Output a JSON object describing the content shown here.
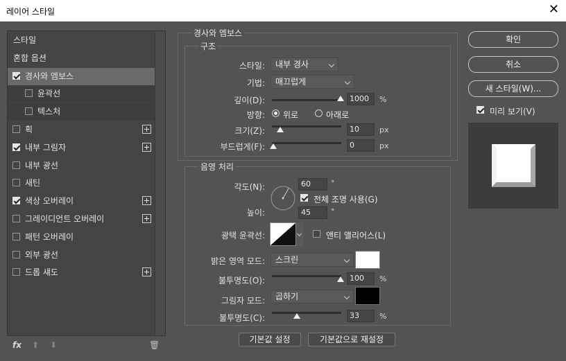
{
  "window": {
    "title": "레이어 스타일",
    "close_glyph": "✕"
  },
  "left": {
    "items": [
      {
        "label": "스타일",
        "has_check": false,
        "checked": false,
        "has_plus": false
      },
      {
        "label": "혼합 옵션",
        "has_check": false,
        "checked": false,
        "has_plus": false
      },
      {
        "label": "경사와 엠보스",
        "has_check": true,
        "checked": true,
        "has_plus": false,
        "selected": true
      },
      {
        "label": "윤곽선",
        "has_check": true,
        "checked": false,
        "has_plus": false,
        "sub": true
      },
      {
        "label": "텍스처",
        "has_check": true,
        "checked": false,
        "has_plus": false,
        "sub": true
      },
      {
        "label": "획",
        "has_check": true,
        "checked": false,
        "has_plus": true
      },
      {
        "label": "내부 그림자",
        "has_check": true,
        "checked": true,
        "has_plus": true
      },
      {
        "label": "내부 광선",
        "has_check": true,
        "checked": false,
        "has_plus": false
      },
      {
        "label": "새틴",
        "has_check": true,
        "checked": false,
        "has_plus": false
      },
      {
        "label": "색상 오버레이",
        "has_check": true,
        "checked": true,
        "has_plus": true
      },
      {
        "label": "그레이디언트 오버레이",
        "has_check": true,
        "checked": false,
        "has_plus": true
      },
      {
        "label": "패턴 오버레이",
        "has_check": true,
        "checked": false,
        "has_plus": false
      },
      {
        "label": "외부 광선",
        "has_check": true,
        "checked": false,
        "has_plus": false
      },
      {
        "label": "드롭 섀도",
        "has_check": true,
        "checked": false,
        "has_plus": true
      }
    ],
    "footer": {
      "fx": "fx",
      "up": "⬆",
      "down": "⬇",
      "trash": "🗑"
    }
  },
  "bevel": {
    "section_title": "경사와 엠보스",
    "structure_title": "구조",
    "style_label": "스타일:",
    "style_value": "내부 경사",
    "technique_label": "기법:",
    "technique_value": "매끄럽게",
    "depth_label": "깊이(D):",
    "depth_value": "1000",
    "depth_unit": "%",
    "direction_label": "방향:",
    "dir_up": "위로",
    "dir_down": "아래로",
    "size_label": "크기(Z):",
    "size_value": "10",
    "size_unit": "px",
    "soften_label": "부드럽게(F):",
    "soften_value": "0",
    "soften_unit": "px"
  },
  "shading": {
    "section_title": "음영 처리",
    "angle_label": "각도(N):",
    "angle_value": "60",
    "angle_unit": "°",
    "global_light_label": "전체 조명 사용(G)",
    "altitude_label": "높이:",
    "altitude_value": "45",
    "altitude_unit": "°",
    "gloss_label": "광택 윤곽선:",
    "antialias_label": "앤티 앨리어스(L)",
    "highlight_mode_label": "밝은 영역 모드:",
    "highlight_mode_value": "스크린",
    "highlight_color": "#ffffff",
    "hl_opacity_label": "불투명도(O):",
    "hl_opacity_value": "100",
    "hl_opacity_unit": "%",
    "shadow_mode_label": "그림자 모드:",
    "shadow_mode_value": "곱하기",
    "shadow_color": "#000000",
    "sh_opacity_label": "불투명도(C):",
    "sh_opacity_value": "33",
    "sh_opacity_unit": "%"
  },
  "bottom_buttons": {
    "make_default": "기본값 설정",
    "reset_default": "기본값으로 재설정"
  },
  "right": {
    "ok": "확인",
    "cancel": "취소",
    "new_style": "새 스타일(W)...",
    "preview_label": "미리 보기(V)"
  }
}
